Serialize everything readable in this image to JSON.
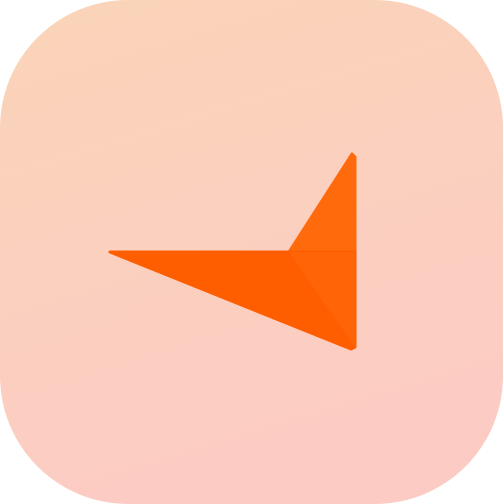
{
  "app_icon": {
    "name": "paper-plane-icon",
    "colors": {
      "background_top": "#FAD4B8",
      "background_bottom": "#FCCCC4",
      "glyph_primary": "#FF6A0D",
      "glyph_dark": "#FF5E00"
    }
  }
}
